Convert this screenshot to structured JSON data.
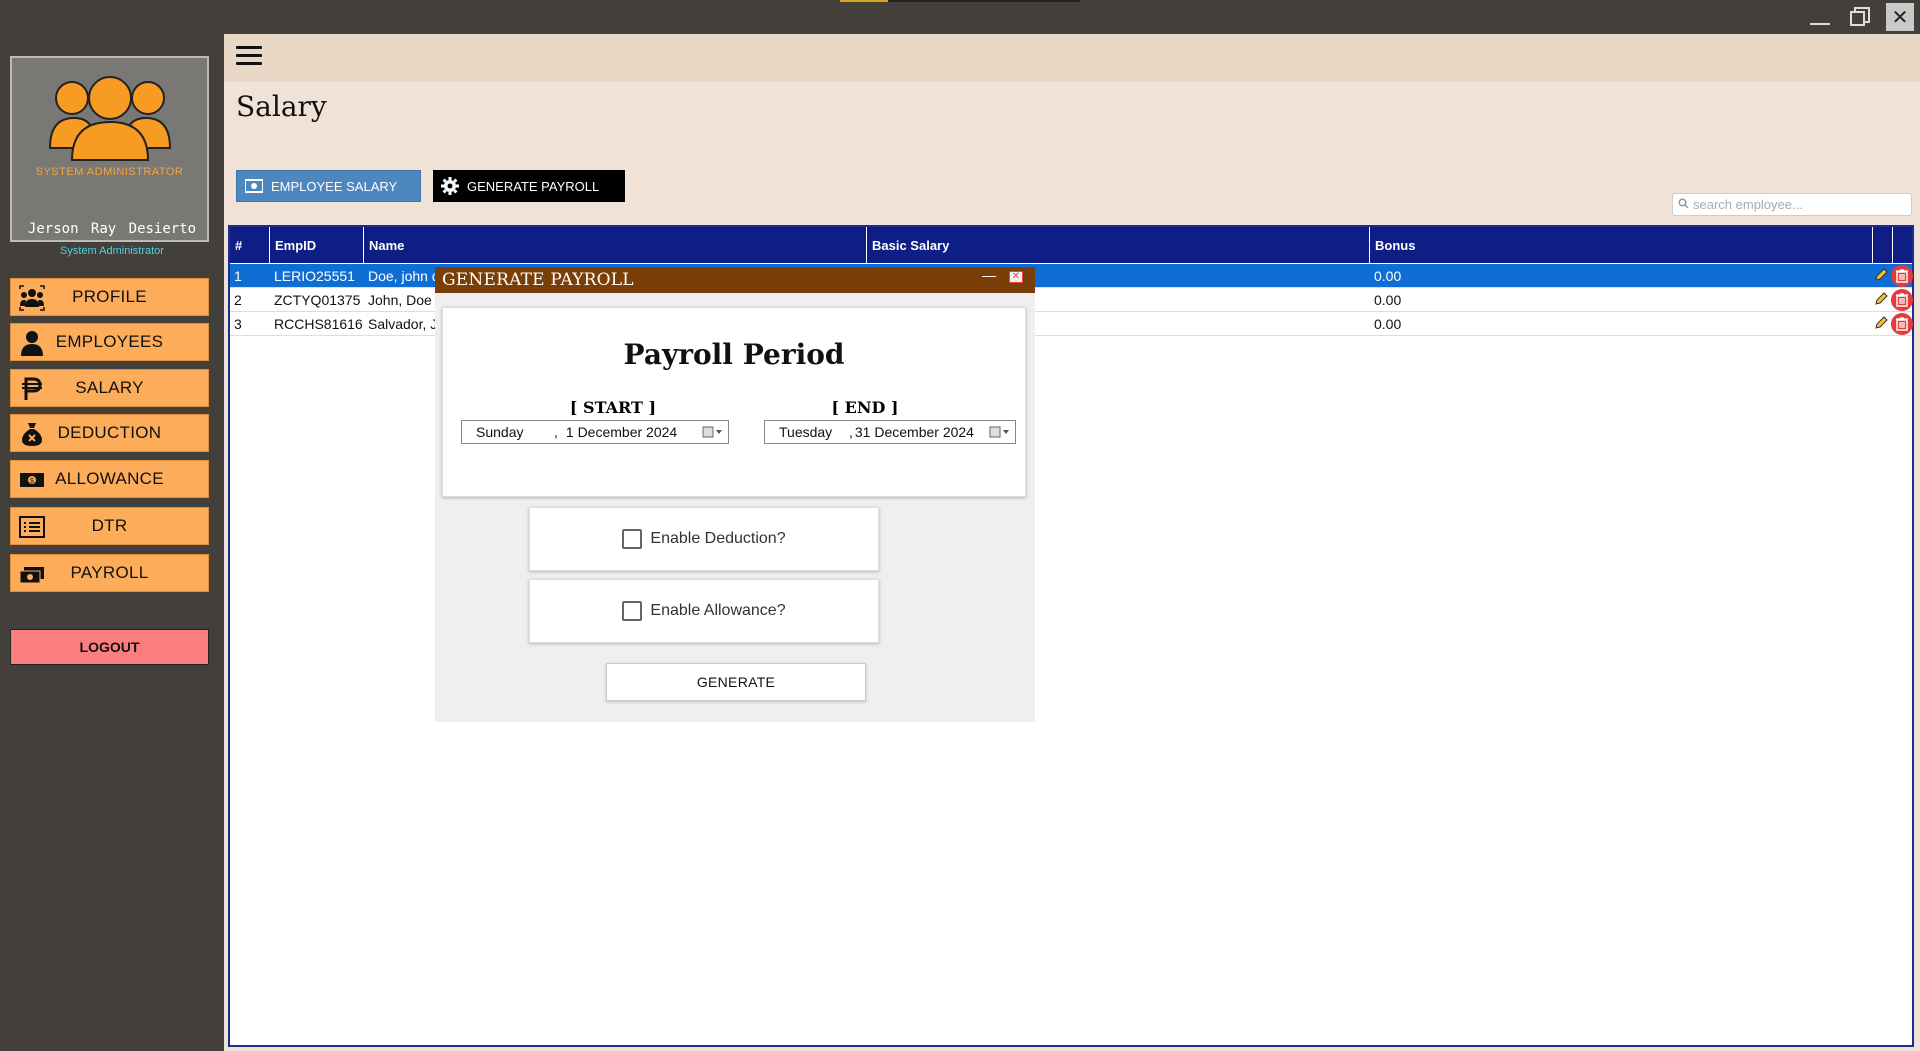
{
  "window": {
    "minimize": "—",
    "close": "✕"
  },
  "sidebar": {
    "avatar_caption": "SYSTEM ADMINISTRATOR",
    "user_name": "Jerson Ray  Desierto",
    "user_role": "System Administrator",
    "items": [
      {
        "label": "PROFILE",
        "icon": "team-icon"
      },
      {
        "label": "EMPLOYEES",
        "icon": "person-icon"
      },
      {
        "label": "SALARY",
        "icon": "peso-icon"
      },
      {
        "label": "DEDUCTION",
        "icon": "money-bag-icon"
      },
      {
        "label": "ALLOWANCE",
        "icon": "cash-icon"
      },
      {
        "label": "DTR",
        "icon": "list-icon"
      },
      {
        "label": "PAYROLL",
        "icon": "payroll-icon"
      }
    ],
    "logout": "LOGOUT"
  },
  "main": {
    "title": "Salary",
    "btn_employee_salary": "EMPLOYEE SALARY",
    "btn_generate_payroll": "GENERATE PAYROLL",
    "search_placeholder": "search employee..."
  },
  "table": {
    "headers": [
      "#",
      "EmpID",
      "Name",
      "Basic Salary",
      "Bonus"
    ],
    "rows": [
      {
        "num": "1",
        "empid": "LERIO25551",
        "name": "Doe, john d",
        "basic": "",
        "bonus": "0.00"
      },
      {
        "num": "2",
        "empid": "ZCTYQ01375",
        "name": "John, Doe",
        "basic": "",
        "bonus": "0.00"
      },
      {
        "num": "3",
        "empid": "RCCHS81616",
        "name": "Salvador, J",
        "basic": "",
        "bonus": "0.00"
      }
    ]
  },
  "dialog": {
    "title": "GENERATE PAYROLL",
    "minimize": "—",
    "close": "✕",
    "period_title": "Payroll Period",
    "start_label": "[ START ]",
    "end_label": "[ END ]",
    "start_day": "Sunday",
    "start_date": "1 December 2024",
    "end_day": "Tuesday",
    "end_date": "31 December 2024",
    "enable_deduction": "Enable Deduction?",
    "enable_allowance": "Enable Allowance?",
    "generate": "GENERATE"
  },
  "colors": {
    "sidebar_bg": "#433f3a",
    "nav_orange": "#fdac5a",
    "table_header": "#0f1e85",
    "selected_row": "#0f6ed6",
    "dialog_title": "#7a3e08",
    "logout": "#fc7d7e"
  }
}
